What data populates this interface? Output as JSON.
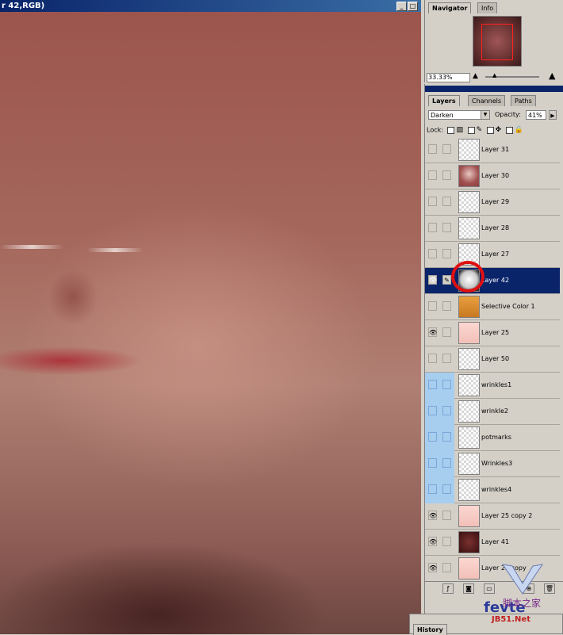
{
  "document": {
    "title": "r 42,RGB)",
    "min_btn": "_",
    "max_btn": "□"
  },
  "navigator": {
    "tabs": [
      "Navigator",
      "Info"
    ],
    "zoom": "33.33%"
  },
  "layers": {
    "tabs": [
      "Layers",
      "Channels",
      "Paths"
    ],
    "blend_mode": "Darken",
    "opacity_label": "Opacity:",
    "opacity": "41%",
    "lock_label": "Lock:",
    "rows": [
      {
        "name": "Layer 31",
        "visible": false,
        "thumb": "transparent"
      },
      {
        "name": "Layer 30",
        "visible": false,
        "thumb": "face"
      },
      {
        "name": "Layer 29",
        "visible": false,
        "thumb": "transparent"
      },
      {
        "name": "Layer 28",
        "visible": false,
        "thumb": "transparent"
      },
      {
        "name": "Layer 27",
        "visible": false,
        "thumb": "transparent"
      },
      {
        "name": "Layer 42",
        "visible": true,
        "selected": true,
        "thumb": "white"
      },
      {
        "name": "Selective Color 1",
        "visible": false,
        "thumb": "adjustment"
      },
      {
        "name": "Layer 25",
        "visible": true,
        "thumb": "pink"
      },
      {
        "name": "Layer 50",
        "visible": false,
        "thumb": "transparent"
      },
      {
        "name": "wrinkles1",
        "visible": false,
        "blue": true,
        "thumb": "transparent"
      },
      {
        "name": "wrinkle2",
        "visible": false,
        "blue": true,
        "thumb": "transparent"
      },
      {
        "name": "potmarks",
        "visible": false,
        "blue": true,
        "thumb": "transparent"
      },
      {
        "name": "Wrinkles3",
        "visible": false,
        "blue": true,
        "thumb": "transparent"
      },
      {
        "name": "wrinkles4",
        "visible": false,
        "blue": true,
        "thumb": "transparent"
      },
      {
        "name": "Layer 25 copy 2",
        "visible": true,
        "thumb": "pink"
      },
      {
        "name": "Layer 41",
        "visible": true,
        "thumb": "dark"
      },
      {
        "name": "Layer 25 copy",
        "visible": true,
        "thumb": "pink"
      }
    ]
  },
  "history": {
    "tab": "History"
  },
  "watermark": {
    "brand": "fevte",
    "cn": "脚本之家",
    "site": "JB51.Net"
  },
  "colors": {
    "selection": "#0a246a",
    "highlight": "#e01010",
    "blue_rows": "#a7cdef"
  }
}
